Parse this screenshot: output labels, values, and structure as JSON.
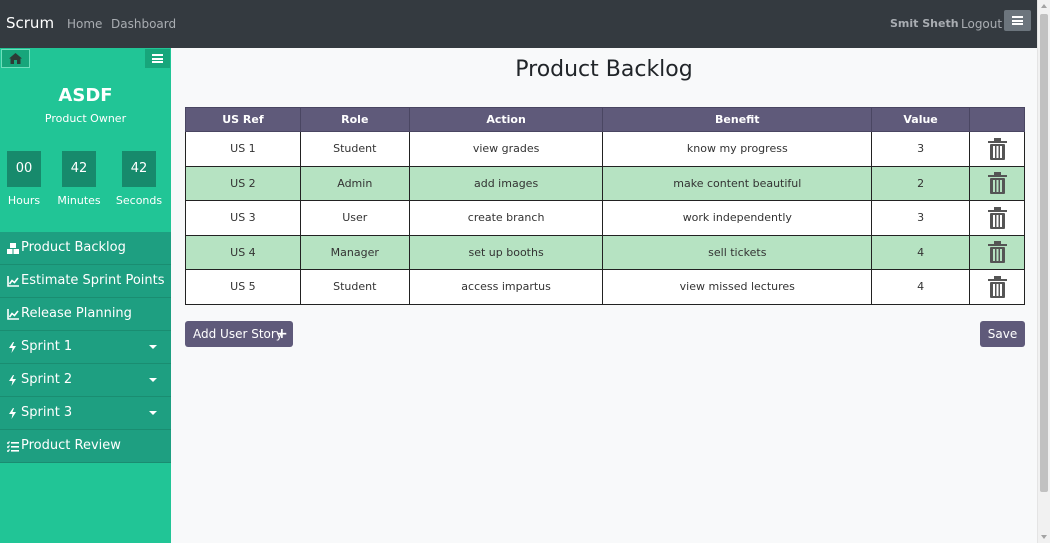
{
  "navbar": {
    "brand": "Scrum",
    "links": [
      "Home",
      "Dashboard"
    ],
    "user": "Smit Sheth",
    "logout": "Logout"
  },
  "sidebar": {
    "team": "ASDF",
    "role": "Product Owner",
    "timer": {
      "hours": "00",
      "minutes": "42",
      "seconds": "42",
      "hours_label": "Hours",
      "minutes_label": "Minutes",
      "seconds_label": "Seconds"
    },
    "items": [
      {
        "label": "Product Backlog",
        "icon": "cubes-icon"
      },
      {
        "label": "Estimate Sprint Points",
        "icon": "line-chart-icon"
      },
      {
        "label": "Release Planning",
        "icon": "line-chart-icon"
      },
      {
        "label": "Sprint 1",
        "icon": "bolt-icon",
        "dropdown": true
      },
      {
        "label": "Sprint 2",
        "icon": "bolt-icon",
        "dropdown": true
      },
      {
        "label": "Sprint 3",
        "icon": "bolt-icon",
        "dropdown": true
      },
      {
        "label": "Product Review",
        "icon": "tasks-icon"
      }
    ]
  },
  "main": {
    "title": "Product Backlog",
    "table": {
      "headers": [
        "US Ref",
        "Role",
        "Action",
        "Benefit",
        "Value",
        ""
      ],
      "rows": [
        {
          "ref": "US 1",
          "role": "Student",
          "action": "view grades",
          "benefit": "know my progress",
          "value": "3"
        },
        {
          "ref": "US 2",
          "role": "Admin",
          "action": "add images",
          "benefit": "make content beautiful",
          "value": "2"
        },
        {
          "ref": "US 3",
          "role": "User",
          "action": "create branch",
          "benefit": "work independently",
          "value": "3"
        },
        {
          "ref": "US 4",
          "role": "Manager",
          "action": "set up booths",
          "benefit": "sell tickets",
          "value": "4"
        },
        {
          "ref": "US 5",
          "role": "Student",
          "action": "access impartus",
          "benefit": "view missed lectures",
          "value": "4"
        }
      ]
    },
    "add_button": "Add User Story",
    "save_button": "Save"
  },
  "colors": {
    "navbar": "#343a40",
    "sidebar": "#21c596",
    "sidebar_item": "#1e9f81",
    "table_header": "#5f5a7a",
    "row_highlight": "#b6e3c2",
    "button": "#5f5a7a"
  }
}
